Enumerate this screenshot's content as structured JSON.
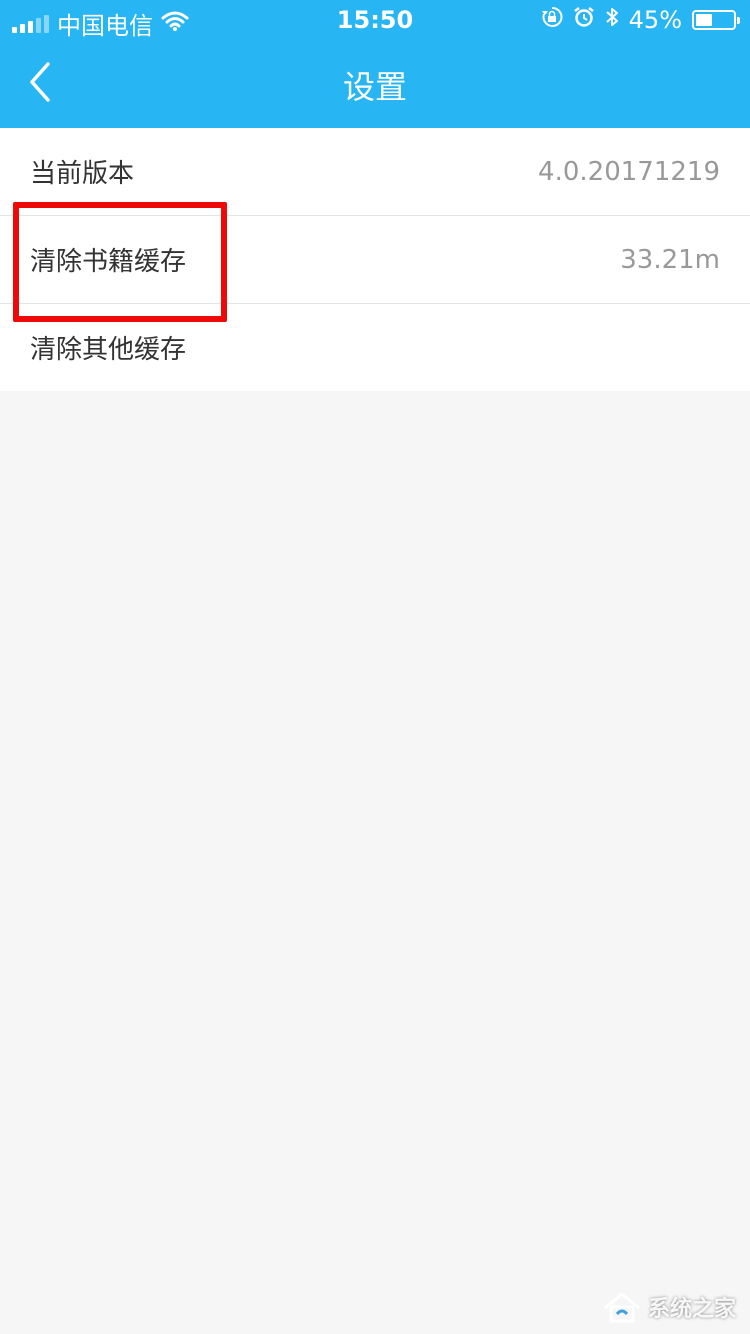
{
  "status_bar": {
    "carrier": "中国电信",
    "time": "15:50",
    "battery_percent": "45%",
    "battery_level": 0.45,
    "icons": [
      "signal-icon",
      "wifi-icon",
      "rotation-lock-icon",
      "alarm-icon",
      "bluetooth-icon",
      "battery-icon"
    ]
  },
  "navbar": {
    "title": "设置",
    "back_icon": "chevron-left-icon"
  },
  "settings": {
    "rows": [
      {
        "label": "当前版本",
        "value": "4.0.20171219"
      },
      {
        "label": "清除书籍缓存",
        "value": "33.21m"
      },
      {
        "label": "清除其他缓存",
        "value": ""
      }
    ]
  },
  "watermark": {
    "text": "系统之家"
  },
  "colors": {
    "header": "#28b5f3",
    "highlight": "#ef0a0a",
    "background": "#f6f6f6"
  }
}
